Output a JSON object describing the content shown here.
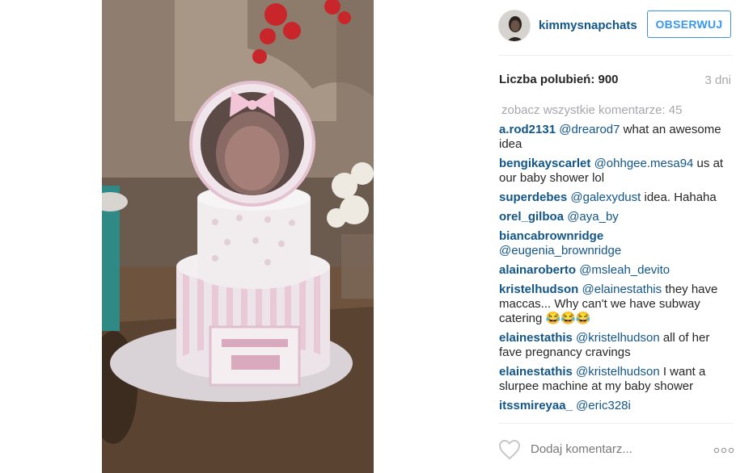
{
  "post": {
    "image_description_icon": "cake-photo",
    "user": {
      "username": "kimmysnapchats"
    },
    "follow_label": "OBSERWUJ",
    "likes_text": "Liczba polubień: 900",
    "age": "3 dni",
    "view_all_comments": "zobacz wszystkie komentarze: 45",
    "comments": [
      {
        "user": "a.rod2131",
        "mention": "@drearod7",
        "text": " what an awesome idea"
      },
      {
        "user": "bengikayscarlet",
        "mention": "@ohhgee.mesa94",
        "text": " us at our baby shower lol"
      },
      {
        "user": "superdebes",
        "mention": "@galexydust",
        "text": " idea. Hahaha"
      },
      {
        "user": "orel_gilboa",
        "mention": "@aya_by",
        "text": ""
      },
      {
        "user": "biancabrownridge",
        "mention": "@eugenia_brownridge",
        "text": ""
      },
      {
        "user": "alainaroberto",
        "mention": "@msleah_devito",
        "text": ""
      },
      {
        "user": "kristelhudson",
        "mention": "@elainestathis",
        "text": " they have maccas... Why can't we have subway catering 😂😂😂"
      },
      {
        "user": "elainestathis",
        "mention": "@kristelhudson",
        "text": " all of her fave pregnancy cravings"
      },
      {
        "user": "elainestathis",
        "mention": "@kristelhudson",
        "text": " I want a slurpee machine at my baby shower"
      },
      {
        "user": "itssmireyaa_",
        "mention": "@eric328i",
        "text": ""
      }
    ],
    "add_comment_placeholder": "Dodaj komentarz...",
    "more_options_icon": "ellipsis-icon",
    "like_icon": "heart-icon"
  },
  "colors": {
    "username_blue": "#125688",
    "follow_blue": "#3897f0",
    "muted_gray": "#a5a7aa"
  }
}
